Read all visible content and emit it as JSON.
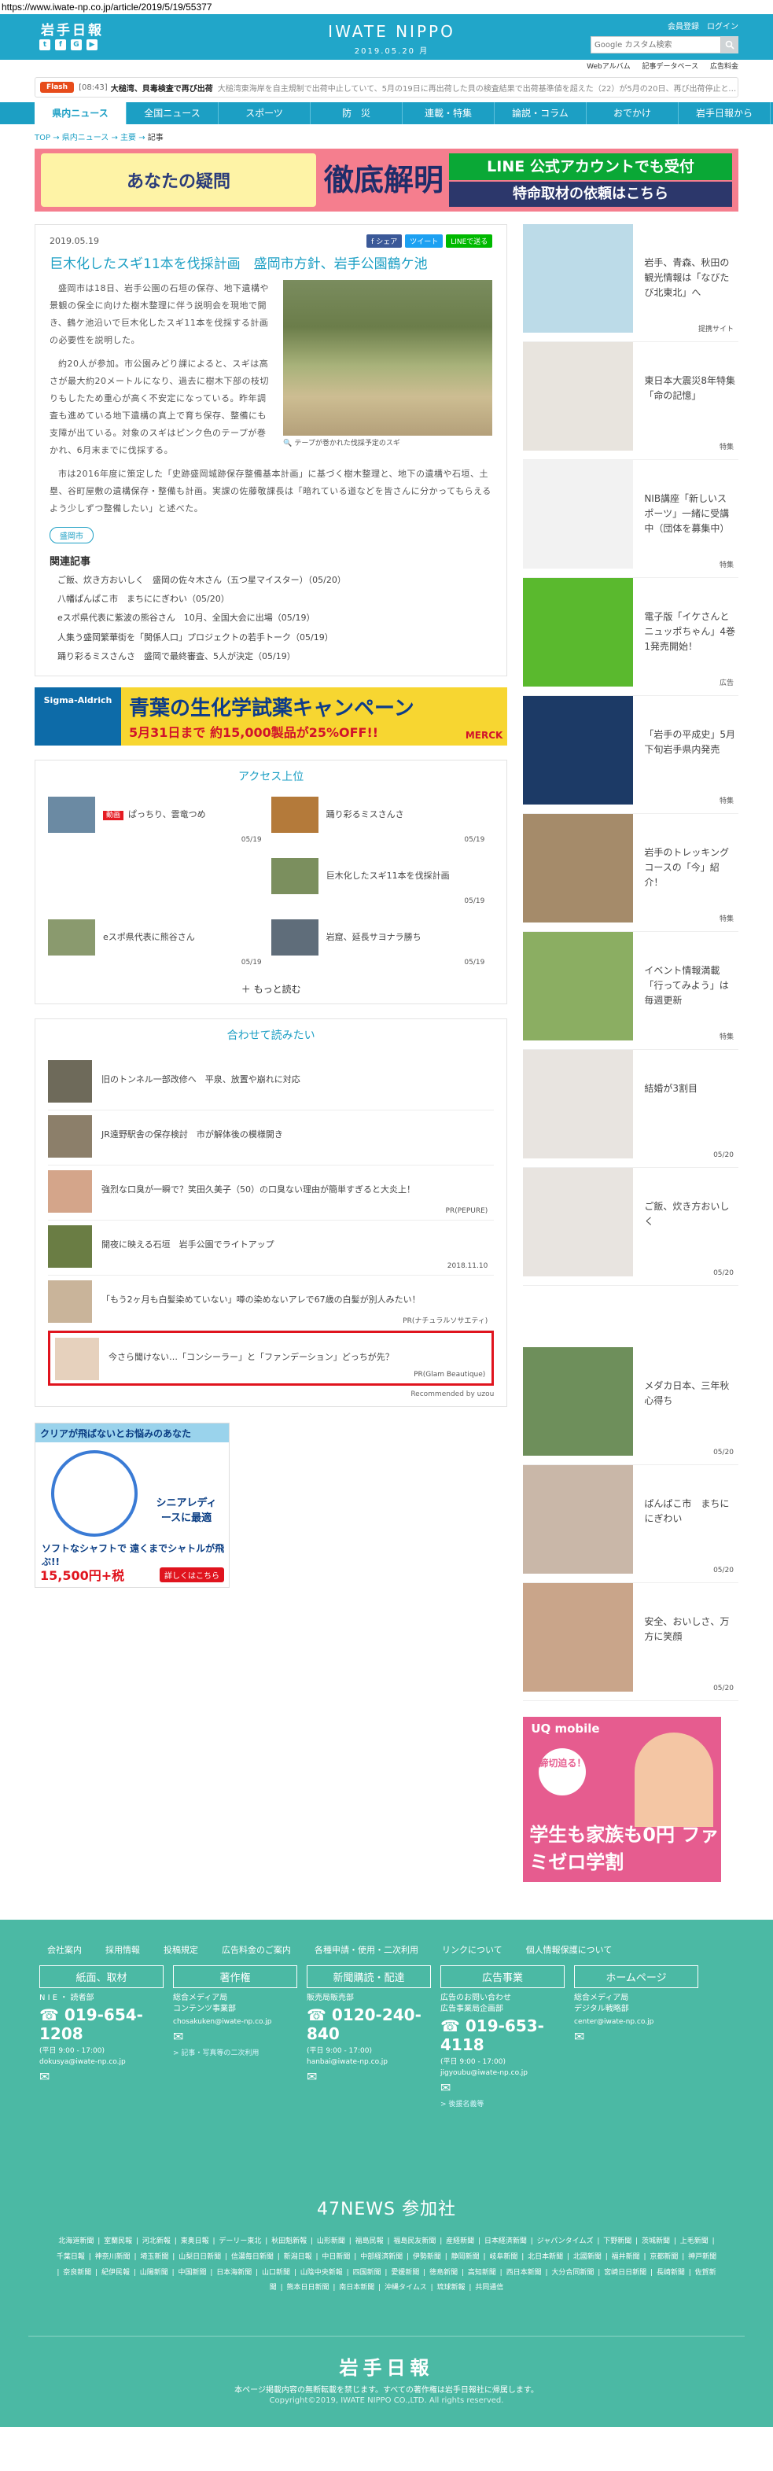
{
  "url": "https://www.iwate-np.co.jp/article/2019/5/19/55377",
  "header": {
    "logo": "岩手日報",
    "social": [
      "t",
      "f",
      "G",
      "▶"
    ],
    "brand": "IWATE NIPPO",
    "date": "2019.05.20 月",
    "links": [
      "会員登録",
      "ログイン"
    ],
    "search_placeholder": "Google カスタム検索"
  },
  "subbar": [
    "Webアルバム",
    "記事データベース",
    "広告料金"
  ],
  "flash": {
    "tag": "Flash",
    "time": "[08:43]",
    "headline": "大槌湾、貝毒検査で再び出荷",
    "body": "大槌湾東海岸を自主規制で出荷中止していて、5月の19日に再出荷した貝の検査結果で出荷基準値を超えた（22）が5月の20日、再び出荷停止となった"
  },
  "nav": [
    "県内ニュース",
    "全国ニュース",
    "スポーツ",
    "防　災",
    "連載・特集",
    "論説・コラム",
    "おでかけ",
    "岩手日報から"
  ],
  "breadcrumb": [
    "TOP",
    "県内ニュース",
    "主要",
    "記事"
  ],
  "topbanner": {
    "left": "あなたの疑問",
    "mid": "徹底解明",
    "line1": "LINE 公式アカウントでも受付",
    "line2": "特命取材の依頼はこちら"
  },
  "article": {
    "date": "2019.05.19",
    "share": [
      "f シェア",
      "ツイート",
      "LINEで送る"
    ],
    "title": "巨木化したスギ11本を伐採計画　盛岡市方針、岩手公園鶴ケ池",
    "caption": "テープが巻かれた伐採予定のスギ",
    "paragraphs": [
      "盛岡市は18日、岩手公園の石垣の保存、地下遺構や景観の保全に向けた樹木整理に伴う説明会を現地で開き、鶴ケ池沿いで巨木化したスギ11本を伐採する計画の必要性を説明した。",
      "約20人が参加。市公園みどり課によると、スギは高さが最大約20メートルになり、過去に樹木下部の枝切りもしたため重心が高く不安定になっている。昨年調査も進めている地下遺構の真上で育ち保存、整備にも支障が出ている。対象のスギはピンク色のテープが巻かれ、6月末までに伐採する。",
      "市は2016年度に策定した「史跡盛岡城跡保存整備基本計画」に基づく樹木整理と、地下の遺構や石垣、土塁、谷町屋敷の遺構保存・整備も計画。実課の佐藤敬課長は「暗れている道などを皆さんに分かってもらえるよう少しずつ整備したい」と述べた。"
    ],
    "tag": "盛岡市",
    "related_title": "関連記事",
    "related": [
      "ご飯、炊き方おいしく　盛岡の佐々木さん（五つ星マイスター）（05/20）",
      "八幡ぱんぱこ市　まちににぎわい（05/20）",
      "eスポ県代表に紫波の熊谷さん　10月、全国大会に出場（05/19）",
      "人集う盛岡繁華街を「関係人口」プロジェクトの若手トーク（05/19）",
      "踊り彩るミスさんさ　盛岡で最終審査、5人が決定（05/19）"
    ]
  },
  "adwide": {
    "brand": "Sigma-Aldrich",
    "copy": "青葉の生化学試薬キャンペーン",
    "copy2": "5月31日まで 約15,000製品が25%OFF!!",
    "logo": "MERCK"
  },
  "ranking": {
    "title": "アクセス上位",
    "items": [
      {
        "badge": "動画",
        "title": "ぱっちり、雲竜つめ",
        "date": "05/19"
      },
      {
        "badge": "",
        "title": "踊り彩るミスさんさ",
        "date": "05/19"
      },
      {
        "badge": "",
        "title": "",
        "date": ""
      },
      {
        "badge": "",
        "title": "巨木化したスギ11本を伐採計画",
        "date": "05/19"
      },
      {
        "badge": "",
        "title": "eスポ県代表に熊谷さん",
        "date": "05/19"
      },
      {
        "badge": "",
        "title": "岩窟、延長サヨナラ勝ち",
        "date": "05/19"
      }
    ],
    "more": "もっと読む"
  },
  "recommend": {
    "title": "合わせて読みたい",
    "items": [
      {
        "title": "旧のトンネル一部改修へ　平泉、放置や崩れに対応",
        "source": ""
      },
      {
        "title": "JR遠野駅舎の保存検討　市が解体後の模様開き",
        "source": ""
      },
      {
        "title": "強烈な口臭が一瞬で？笑田久美子（50）の口臭ない理由が簡単すぎると大炎上！",
        "source": "PR(PEPURE)"
      },
      {
        "title": "開夜に映える石垣　岩手公園でライトアップ",
        "source": "2018.11.10"
      },
      {
        "title": "「もう2ヶ月も白髪染めていない」噂の染めないアレで67歳の白髪が別人みたい！",
        "source": "PR(ナチュラルソサエティ)"
      },
      {
        "title": "今さら聞けない…「コンシーラー」と「ファンデーション」どっちが先？",
        "source": "PR(Glam Beautique)"
      }
    ],
    "powered": "Recommended by uzou"
  },
  "smallad": {
    "top": "クリアが飛ばないとお悩みのあなた",
    "label1": "シニアレディースに最適",
    "label2": "ソフトなシャフトで 遠くまでシャトルが飛ぶ!!",
    "price": "15,500円+税",
    "detail": "詳しくはこちら"
  },
  "sidebar": [
    {
      "title": "岩手、青森、秋田の観光情報は「なびたび北東北」へ",
      "tag": "提携サイト",
      "color": "#bcdbe8"
    },
    {
      "title": "東日本大震災8年特集「命の記憶」",
      "tag": "特集",
      "color": "#e8e4de"
    },
    {
      "title": "NIB講座「新しいスポーツ」一緒に受講中（団体を募集中）",
      "tag": "特集",
      "color": "#f2f2f2"
    },
    {
      "title": "電子版「イケさんとニュッポちゃん」4巻1発売開始！",
      "tag": "広告",
      "color": "#5ab92e"
    },
    {
      "title": "「岩手の平成史」5月下旬岩手県内発売",
      "tag": "特集",
      "color": "#1c3a66"
    },
    {
      "title": "岩手のトレッキングコースの「今」紹介！",
      "tag": "特集",
      "color": "#a58b6a"
    },
    {
      "title": "イベント情報満載「行ってみよう」は毎週更新",
      "tag": "特集",
      "color": "#8bae62"
    },
    {
      "title": "結婚が3割目",
      "tag": "05/20",
      "color": "#e8e4e0"
    },
    {
      "title": "ご飯、炊き方おいしく",
      "tag": "05/20",
      "color": "#e8e4e0"
    },
    {
      "title": "メダカ日本、三年秋心得ち",
      "tag": "05/20",
      "color": "#6e8f5b"
    },
    {
      "title": "ぱんぱこ市　まちににぎわい",
      "tag": "05/20",
      "color": "#c9b7a8"
    },
    {
      "title": "安全、おいしさ、万方に笑顔",
      "tag": "05/20",
      "color": "#c9a58a"
    }
  ],
  "uqad": {
    "logo": "UQ mobile",
    "circle": "締切迫る！",
    "main": "学生も家族も0円 ファミゼロ学割"
  },
  "footer": {
    "links": [
      "会社案内",
      "採用情報",
      "投稿規定",
      "広告料金のご案内",
      "各種申請・使用・二次利用",
      "リンクについて",
      "個人情報保護について"
    ],
    "cols": [
      {
        "head": "紙面、取材",
        "lines": [
          "N I E ・ 読者部"
        ],
        "phone": "019-654-1208",
        "hours": "(平日 9:00 - 17:00)",
        "mail": "dokusya@iwate-np.co.jp",
        "link": ""
      },
      {
        "head": "著作権",
        "lines": [
          "総合メディア局",
          "コンテンツ事業部"
        ],
        "phone": "",
        "hours": "",
        "mail": "chosakuken@iwate-np.co.jp",
        "link": "> 記事・写真等の二次利用"
      },
      {
        "head": "新聞購読・配達",
        "lines": [
          "販売局販売部"
        ],
        "phone": "0120-240-840",
        "hours": "(平日 9:00 - 17:00)",
        "mail": "hanbai@iwate-np.co.jp",
        "link": ""
      },
      {
        "head": "広告事業",
        "lines": [
          "広告のお問い合わせ",
          "広告事業局企画部"
        ],
        "phone": "019-653-4118",
        "hours": "(平日 9:00 - 17:00)",
        "mail": "jigyoubu@iwate-np.co.jp",
        "link": "> 後援名義等"
      },
      {
        "head": "ホームページ",
        "lines": [
          "総合メディア局",
          "デジタル戦略部"
        ],
        "phone": "",
        "hours": "",
        "mail": "center@iwate-np.co.jp",
        "link": ""
      }
    ],
    "section": "47NEWS 参加社",
    "members": "北海道新聞 | 室蘭民報 | 河北新報 | 東奥日報 | デーリー東北 | 秋田魁新報 | 山形新聞 | 福島民報 | 福島民友新聞 | 産経新聞 | 日本経済新聞 | ジャパンタイムズ | 下野新聞 | 茨城新聞 | 上毛新聞 | 千葉日報 | 神奈川新聞 | 埼玉新聞 | 山梨日日新聞 | 信濃毎日新聞 | 新潟日報 | 中日新聞 | 中部経済新聞 | 伊勢新聞 | 静岡新聞 | 岐阜新聞 | 北日本新聞 | 北國新聞 | 福井新聞 | 京都新聞 | 神戸新聞 | 奈良新聞 | 紀伊民報 | 山陽新聞 | 中国新聞 | 日本海新聞 | 山口新聞 | 山陰中央新報 | 四国新聞 | 愛媛新聞 | 徳島新聞 | 高知新聞 | 西日本新聞 | 大分合同新聞 | 宮崎日日新聞 | 長崎新聞 | 佐賀新聞 | 熊本日日新聞 | 南日本新聞 | 沖縄タイムス | 琉球新報 | 共同通信",
    "logo": "岩手日報",
    "note": "本ページ掲載内容の無断転載を禁じます。すべての著作権は岩手日報社に帰属します。",
    "copyright": "Copyright©2019, IWATE NIPPO CO.,LTD. All rights reserved."
  }
}
